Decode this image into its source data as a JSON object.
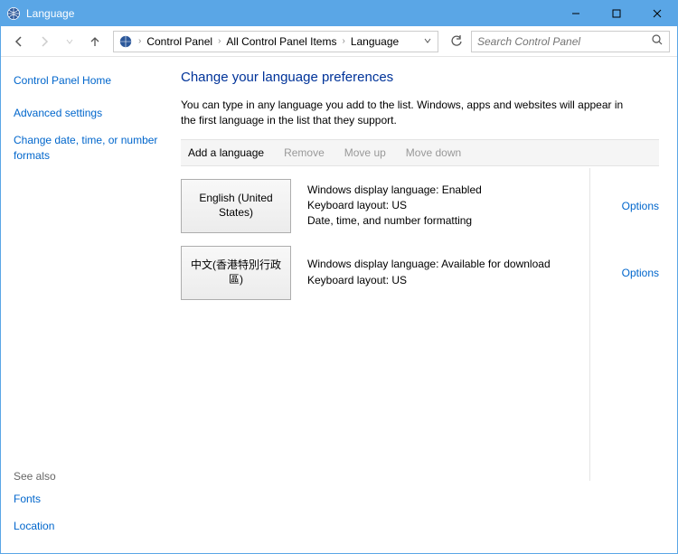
{
  "window": {
    "title": "Language"
  },
  "breadcrumb": {
    "items": [
      "Control Panel",
      "All Control Panel Items",
      "Language"
    ]
  },
  "search": {
    "placeholder": "Search Control Panel"
  },
  "sidebar": {
    "home": "Control Panel Home",
    "links": [
      "Advanced settings",
      "Change date, time, or number formats"
    ],
    "see_also_label": "See also",
    "see_also": [
      "Fonts",
      "Location"
    ]
  },
  "page": {
    "title": "Change your language preferences",
    "desc": "You can type in any language you add to the list. Windows, apps and websites will appear in the first language in the list that they support."
  },
  "actions": {
    "add": "Add a language",
    "remove": "Remove",
    "up": "Move up",
    "down": "Move down"
  },
  "languages": [
    {
      "name": "English (United States)",
      "detail1": "Windows display language: Enabled",
      "detail2": "Keyboard layout: US",
      "detail3": "Date, time, and number formatting",
      "options": "Options"
    },
    {
      "name": "中文(香港特別行政區)",
      "detail1": "Windows display language: Available for download",
      "detail2": "Keyboard layout: US",
      "detail3": "",
      "options": "Options"
    }
  ]
}
